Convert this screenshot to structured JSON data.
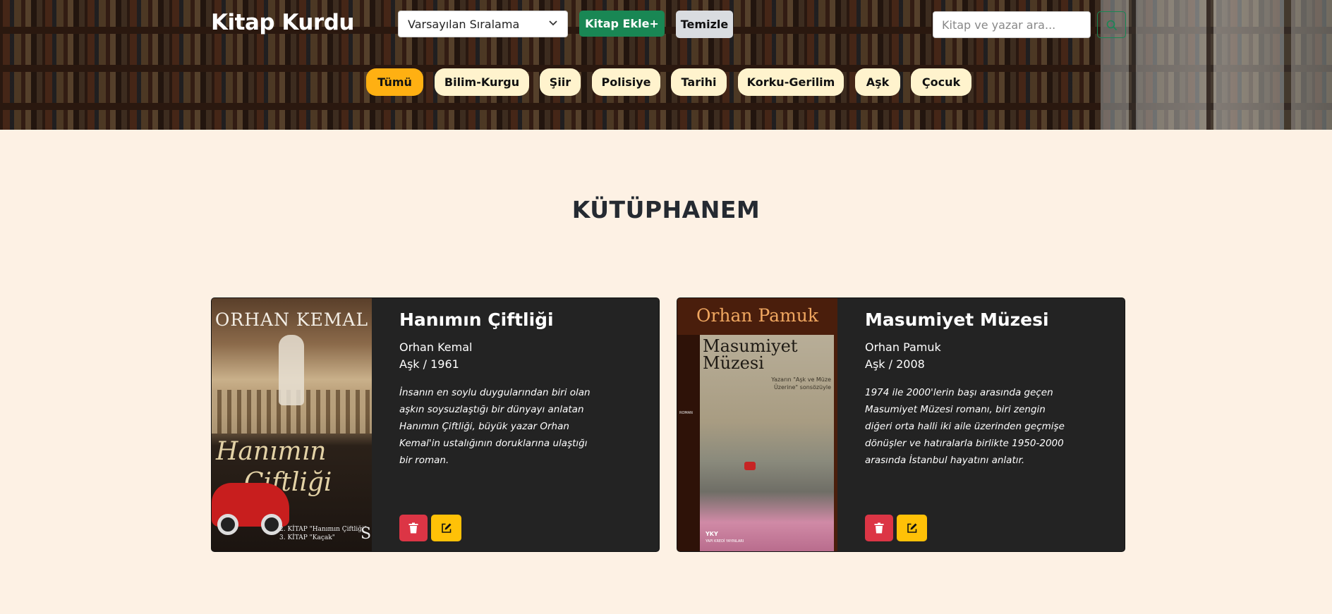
{
  "header": {
    "brand": "Kitap Kurdu",
    "sort_select": {
      "selected": "Varsayılan Sıralama",
      "chevron": "⌵"
    },
    "add_button_label": "Kitap Ekle+",
    "clear_button_label": "Temizle",
    "search": {
      "placeholder": "Kitap ve yazar ara...",
      "icon": "search-icon"
    }
  },
  "categories": [
    {
      "label": "Tümü",
      "active": true
    },
    {
      "label": "Bilim-Kurgu",
      "active": false
    },
    {
      "label": "Şiir",
      "active": false
    },
    {
      "label": "Polisiye",
      "active": false
    },
    {
      "label": "Tarihi",
      "active": false
    },
    {
      "label": "Korku-Gerilim",
      "active": false
    },
    {
      "label": "Aşk",
      "active": false
    },
    {
      "label": "Çocuk",
      "active": false
    }
  ],
  "main": {
    "title": "KÜTÜPHANEM",
    "books": [
      {
        "title": "Hanımın Çiftliği",
        "author": "Orhan Kemal",
        "category": "Aşk",
        "year": "1961",
        "description": "İnsanın en soylu duygularından biri olan aşkın soysuzlaştığı bir dünyayı anlatan Hanımın Çiftliği, büyük yazar Orhan Kemal'in ustalığının doruklarına ulaştığı bir roman.",
        "cover": {
          "author_line": "ORHAN KEMAL",
          "title_line_1": "Hanımın",
          "title_line_2": "Çiftliği",
          "foot_line_1": "2. KİTAP \"Hanımın Çiftliği\"",
          "foot_line_2": "3. KİTAP \"Kaçak\"",
          "publisher_mark": "S"
        }
      },
      {
        "title": "Masumiyet Müzesi",
        "author": "Orhan Pamuk",
        "category": "Aşk",
        "year": "2008",
        "description": "1974 ile 2000'lerin başı arasında geçen Masumiyet Müzesi romanı, biri zengin diğeri orta halli iki aile üzerinden geçmişe dönüşler ve hatıralarla birlikte 1950-2000 arasında İstanbul hayatını anlatır.",
        "cover": {
          "author_line": "Orhan Pamuk",
          "title_line_1": "Masumiyet",
          "title_line_2": "Müzesi",
          "subtitle": "Yazarın \"Aşk ve Müze Üzerine\" sonsözüyle",
          "spine": "ROMAN",
          "publisher_logo": "YKY",
          "publisher_name": "YAPI KREDİ YAYINLARI"
        }
      }
    ]
  },
  "colors": {
    "accent_active": "#ffb012",
    "chip": "#fff3cd",
    "add": "#198754",
    "delete": "#dc3545",
    "edit": "#ffc107",
    "card_bg": "#232323",
    "page_bg": "#fdf1e4"
  }
}
